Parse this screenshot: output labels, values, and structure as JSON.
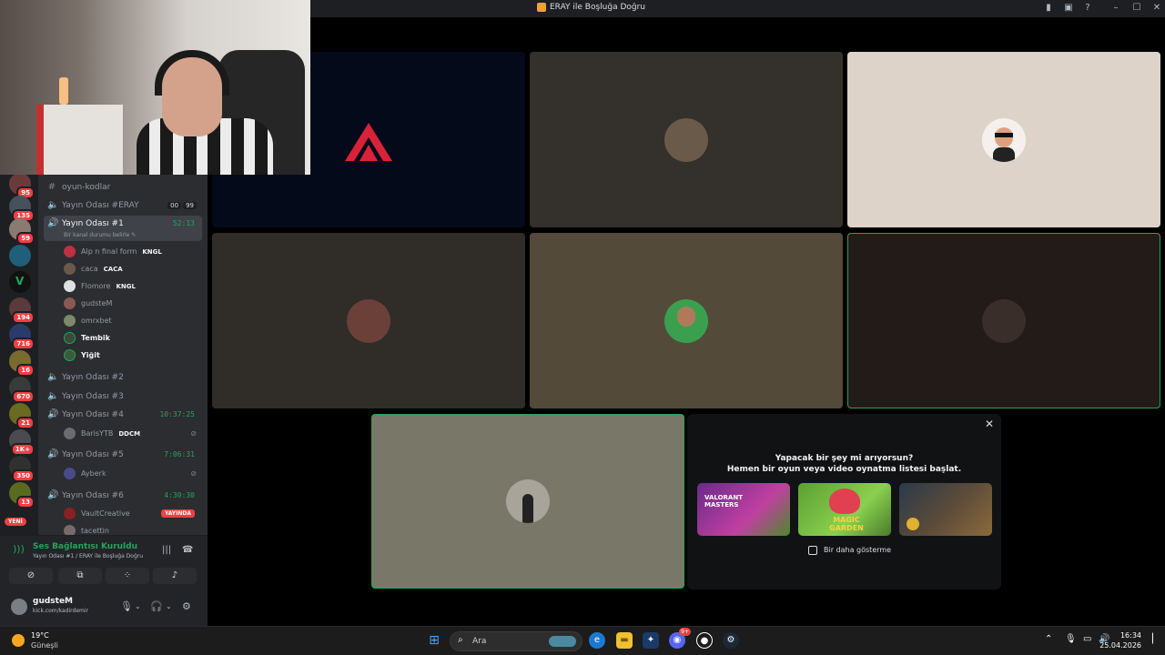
{
  "window": {
    "title": "ERAY ile Boşluğa Doğru"
  },
  "servers": [
    {
      "badge": "95"
    },
    {
      "badge": "135"
    },
    {
      "badge": "59"
    },
    {
      "badge": ""
    },
    {
      "badge": ""
    },
    {
      "badge": "194"
    },
    {
      "badge": "716"
    },
    {
      "badge": "16"
    },
    {
      "badge": "670"
    },
    {
      "badge": "21"
    },
    {
      "badge": "1K+"
    },
    {
      "badge": "350"
    },
    {
      "badge": "13"
    }
  ],
  "servers_new_label": "YENİ",
  "channels": {
    "text_channel": "oyun-kodlar",
    "voice": [
      {
        "name": "Yayın Odası #ERAY",
        "counter": [
          "00",
          "99"
        ]
      },
      {
        "name": "Yayın Odası #1",
        "timer": "52:13",
        "sub": "Bir kanal durumu belirle"
      },
      {
        "name": "Yayın Odası #2"
      },
      {
        "name": "Yayın Odası #3"
      },
      {
        "name": "Yayın Odası #4",
        "timer": "10:37:25"
      },
      {
        "name": "Yayın Odası #5",
        "timer": "7:06:31"
      },
      {
        "name": "Yayın Odası #6",
        "timer": "4:30:30"
      }
    ],
    "room1_members": [
      {
        "name": "Alp n final form",
        "tag": "KNGL"
      },
      {
        "name": "caca",
        "tag": "CACA"
      },
      {
        "name": "Flomore",
        "tag": "KNGL"
      },
      {
        "name": "gudsteM",
        "tag": ""
      },
      {
        "name": "omrxbet",
        "tag": ""
      },
      {
        "name": "Tembik",
        "tag": ""
      },
      {
        "name": "Yiğit",
        "tag": ""
      }
    ],
    "room4_members": [
      {
        "name": "BarisYTB",
        "tag": "DDCM"
      }
    ],
    "room5_members": [
      {
        "name": "Ayberk",
        "tag": ""
      }
    ],
    "room6_members": [
      {
        "name": "VaultCreative",
        "live": "YAYINDA"
      },
      {
        "name": "tacettin"
      }
    ]
  },
  "voice_panel": {
    "status": "Ses Bağlantısı Kuruldu",
    "sub": "Yayın Odası #1 / ERAY ile Boşluğa Doğru"
  },
  "user_panel": {
    "name": "gudsteM",
    "sub": "kick.com/kadirdemir"
  },
  "activity": {
    "line1": "Yapacak bir şey mi arıyorsun?",
    "line2": "Hemen bir oyun veya video oynatma listesi başlat.",
    "cards": [
      {
        "label": "VALORANT MASTERS"
      },
      {
        "label": "MAGIC GARDEN"
      },
      {
        "label": ""
      }
    ],
    "dont_show": "Bir daha gösterme"
  },
  "taskbar": {
    "temp": "19°C",
    "condition": "Güneşli",
    "search_placeholder": "Ara",
    "time": "16:34",
    "date": "25.04.2026",
    "discord_badge": "9+"
  },
  "colors": {
    "accent_green": "#23a55a",
    "alert_red": "#f23f43",
    "sidebar_bg": "#2b2d31"
  }
}
